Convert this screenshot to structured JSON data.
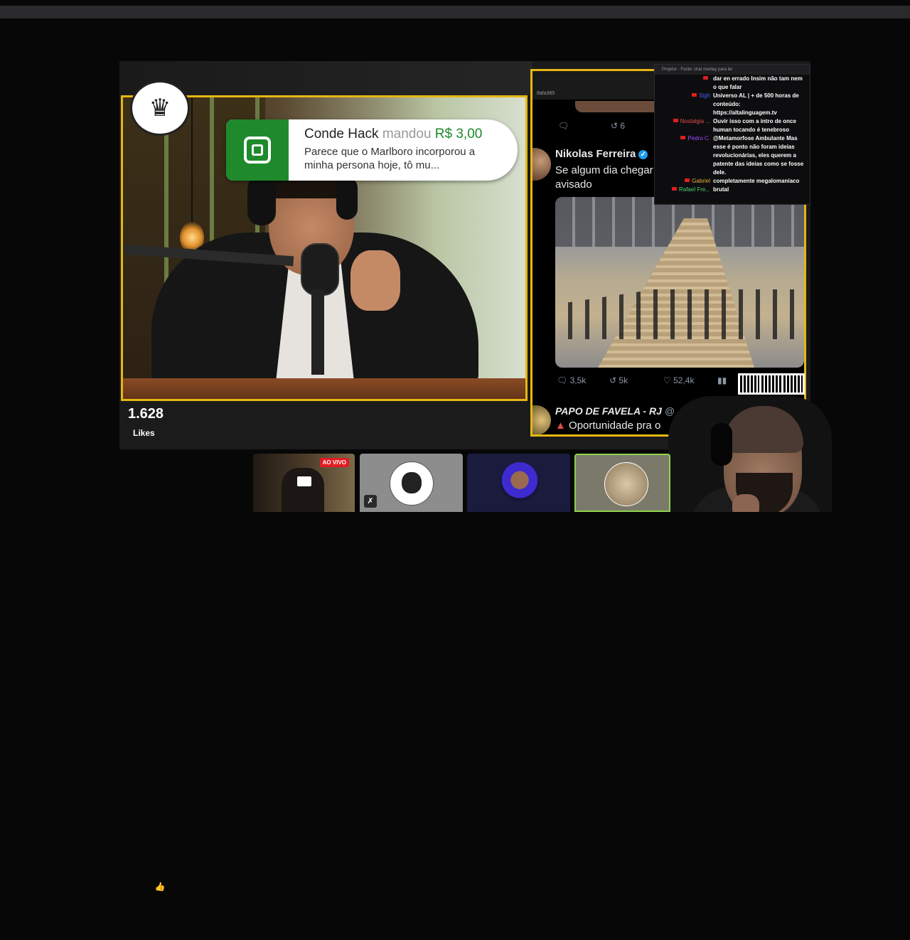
{
  "donation": {
    "donor": "Conde Hack",
    "verb": "mandou",
    "amount": "R$ 3,00",
    "message": "Parece que o Marlboro incorporou a minha persona hoje, tô mu..."
  },
  "likes": {
    "count": "1.628",
    "label": "Likes",
    "icon": "thumbs-up-icon"
  },
  "tweet_panel": {
    "url_fragment": "8afa385",
    "prev_tweet": {
      "retweets": "6"
    },
    "tweet1": {
      "author": "Nikolas Ferreira",
      "text_line1": "Se algum dia chegar",
      "text_line2": "avisado",
      "replies": "3,5k",
      "retweets": "5k",
      "likes": "52,4k"
    },
    "tweet2": {
      "author": "PAPO DE FAVELA - RJ",
      "handle": "@",
      "text": "Oportunidade pra o"
    }
  },
  "chat": {
    "title": "Projetor - Fonte: chat overlay para ler",
    "messages": [
      {
        "user": "",
        "user_color": "#e14b4b",
        "text": "dar en errado Insim não tam nem o que falar"
      },
      {
        "user": "Sigh",
        "user_color": "#4b5cff",
        "text": "Universo AL | + de 500 horas de conteúdo: https://altalinguagem.tv"
      },
      {
        "user": "Nostalgia ...",
        "user_color": "#e14b4b",
        "text": "Ouvir isso com a intro de once human tocando é tenebroso"
      },
      {
        "user": "Pedro C.",
        "user_color": "#9d4bff",
        "text": "@Metamorfose Ambulante Mas esse é ponto não foram ideias revolucionárias, eles querem a patente das ideias como se fosse dele."
      },
      {
        "user": "Gabriel",
        "user_color": "#e3b33b",
        "text": "completamente megalomaníaco"
      },
      {
        "user": "Rafael Fre...",
        "user_color": "#4bd16f",
        "text": "brutal"
      }
    ]
  },
  "thumbnails": {
    "live_badge": "AO VIVO"
  },
  "colors": {
    "frame_yellow": "#e6b712",
    "donation_green": "#1f8a2b",
    "live_red": "#e31b23"
  }
}
